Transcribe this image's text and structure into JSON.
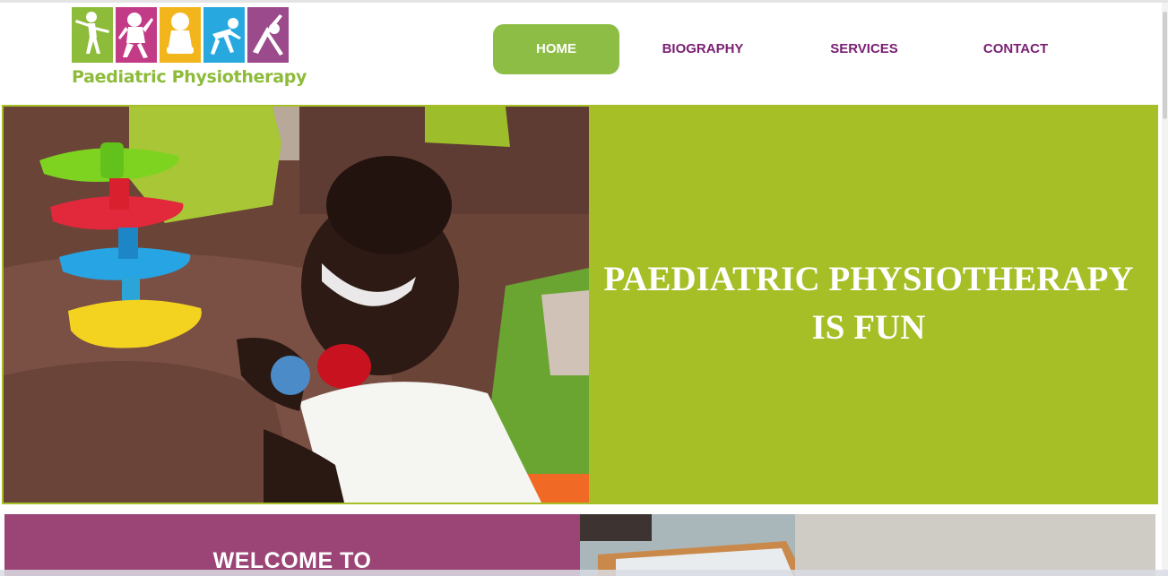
{
  "header": {
    "logo": {
      "text_part1": "Paediatric",
      "text_part2": "Physiotherapy",
      "tile_colors": [
        "#8dbb3a",
        "#c23b87",
        "#f2b51c",
        "#27a9e0",
        "#9b4a8c"
      ]
    },
    "nav": [
      {
        "label": "HOME",
        "active": true
      },
      {
        "label": "BIOGRAPHY",
        "active": false
      },
      {
        "label": "SERVICES",
        "active": false
      },
      {
        "label": "CONTACT",
        "active": false
      }
    ]
  },
  "hero": {
    "title_line1": "PAEDIATRIC PHYSIOTHERAPY",
    "title_line2": "IS FUN",
    "panel_color": "#a6bf27"
  },
  "welcome": {
    "title": "WELCOME TO",
    "panel_color": "#9b4577"
  },
  "colors": {
    "accent_green": "#8dbd45",
    "nav_text": "#7a1f73"
  }
}
